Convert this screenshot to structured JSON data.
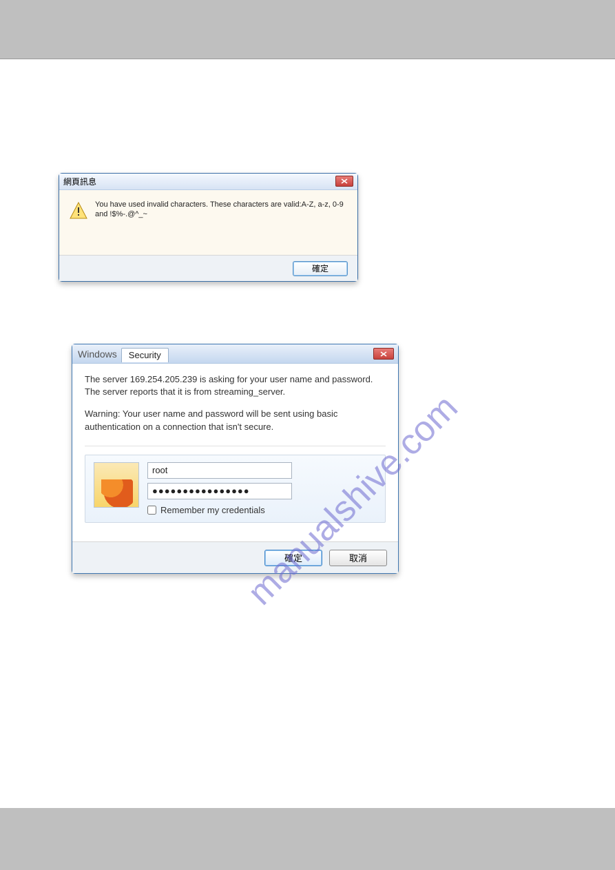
{
  "dialog1": {
    "title": "網頁訊息",
    "message": "You have used invalid characters. These characters are valid:A-Z, a-z, 0-9 and !$%-.@^_~",
    "ok_label": "確定"
  },
  "dialog2": {
    "title_prefix": "Windows",
    "title_tab": "Security",
    "paragraph1": "The server 169.254.205.239 is asking for your user name and password. The server reports that it is from streaming_server.",
    "paragraph2": "Warning: Your user name and password will be sent using basic authentication on a connection that isn't secure.",
    "username_value": "root",
    "password_value": "●●●●●●●●●●●●●●●●",
    "remember_label": "Remember my credentials",
    "ok_label": "確定",
    "cancel_label": "取消"
  },
  "watermark": {
    "text": "manualshive.com"
  }
}
